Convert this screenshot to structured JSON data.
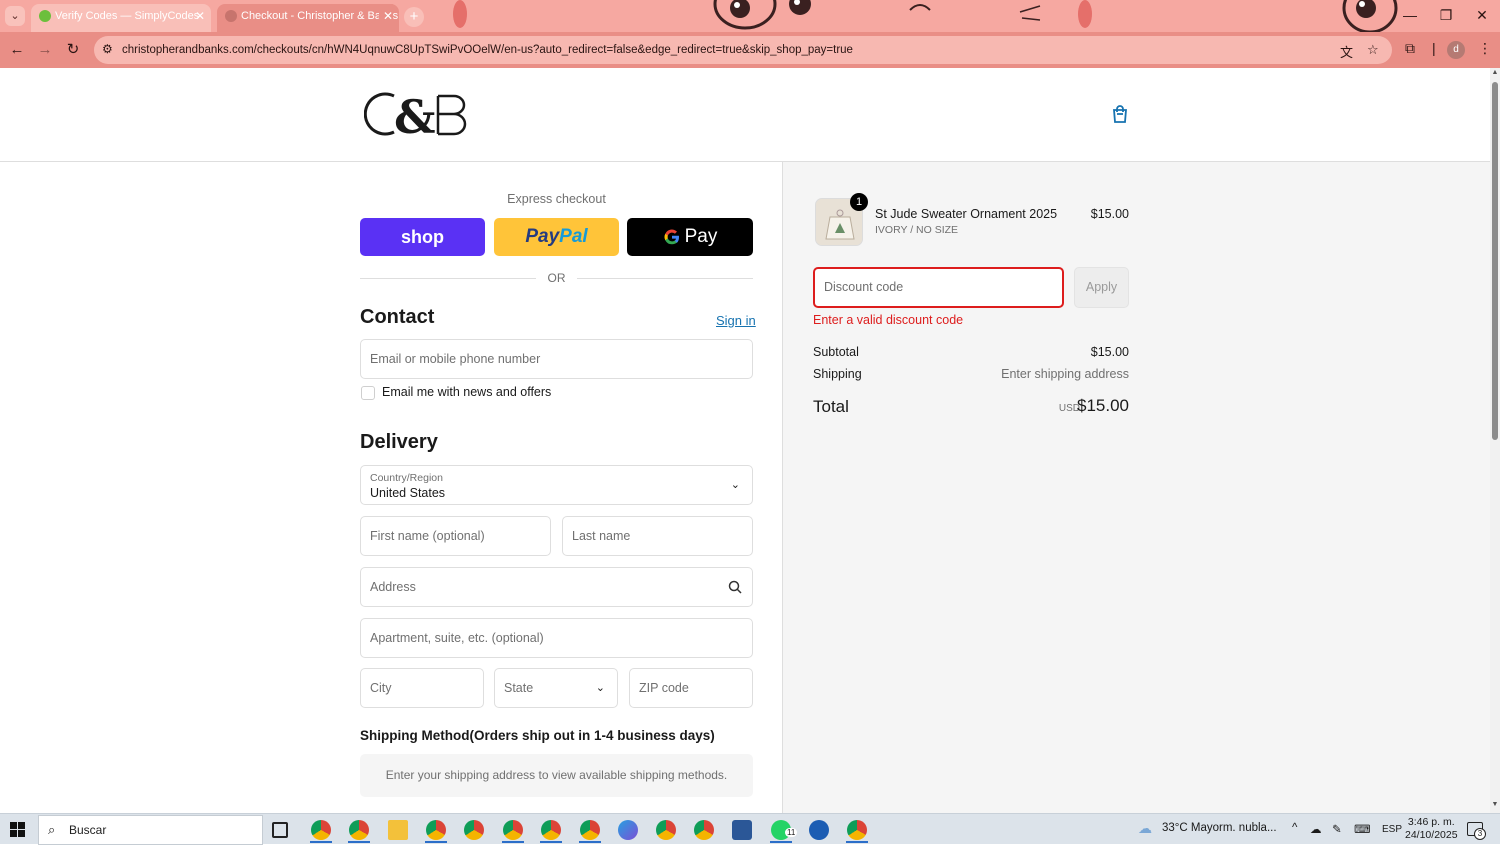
{
  "browser": {
    "tabs": [
      {
        "title": "Verify Codes — SimplyCodes",
        "active": false
      },
      {
        "title": "Checkout - Christopher & Banks",
        "active": true
      }
    ],
    "url": "christopherandbanks.com/checkouts/cn/hWN4UqnuwC8UpTSwiPvOOelW/en-us?auto_redirect=false&edge_redirect=true&skip_shop_pay=true",
    "profile_initial": "d",
    "theme_color": "#e98e86"
  },
  "header": {
    "logo_text": "C&B",
    "cart_icon": "shopping-bag-icon"
  },
  "express": {
    "label": "Express checkout",
    "shop_label": "shop",
    "paypal_part1": "Pay",
    "paypal_part2": "Pal",
    "gpay_label": "Pay",
    "or_label": "OR"
  },
  "contact": {
    "title": "Contact",
    "signin_label": "Sign in",
    "email_placeholder": "Email or mobile phone number",
    "newsletter_label": "Email me with news and offers",
    "newsletter_checked": false
  },
  "delivery": {
    "title": "Delivery",
    "country_label": "Country/Region",
    "country_value": "United States",
    "first_name_placeholder": "First name (optional)",
    "last_name_placeholder": "Last name",
    "address_placeholder": "Address",
    "apartment_placeholder": "Apartment, suite, etc. (optional)",
    "city_placeholder": "City",
    "state_placeholder": "State",
    "zip_placeholder": "ZIP code"
  },
  "shipping_method": {
    "title": "Shipping Method(Orders ship out in 1-4 business days)",
    "message": "Enter your shipping address to view available shipping methods."
  },
  "order_summary": {
    "item": {
      "quantity": "1",
      "name": "St Jude Sweater Ornament 2025",
      "variant": "IVORY / NO SIZE",
      "price": "$15.00"
    },
    "discount_placeholder": "Discount code",
    "apply_label": "Apply",
    "discount_error": "Enter a valid discount code",
    "subtotal_label": "Subtotal",
    "subtotal_value": "$15.00",
    "shipping_label": "Shipping",
    "shipping_value": "Enter shipping address",
    "total_label": "Total",
    "total_currency": "USD",
    "total_value": "$15.00",
    "error_color": "#dd1d1d",
    "link_color": "#1773b0"
  },
  "taskbar": {
    "search_label": "Buscar",
    "weather": "33°C  Mayorm. nubla...",
    "language": "ESP",
    "time": "3:46 p. m.",
    "date": "24/10/2025",
    "notification_count": "3",
    "whatsapp_badge": "11"
  }
}
